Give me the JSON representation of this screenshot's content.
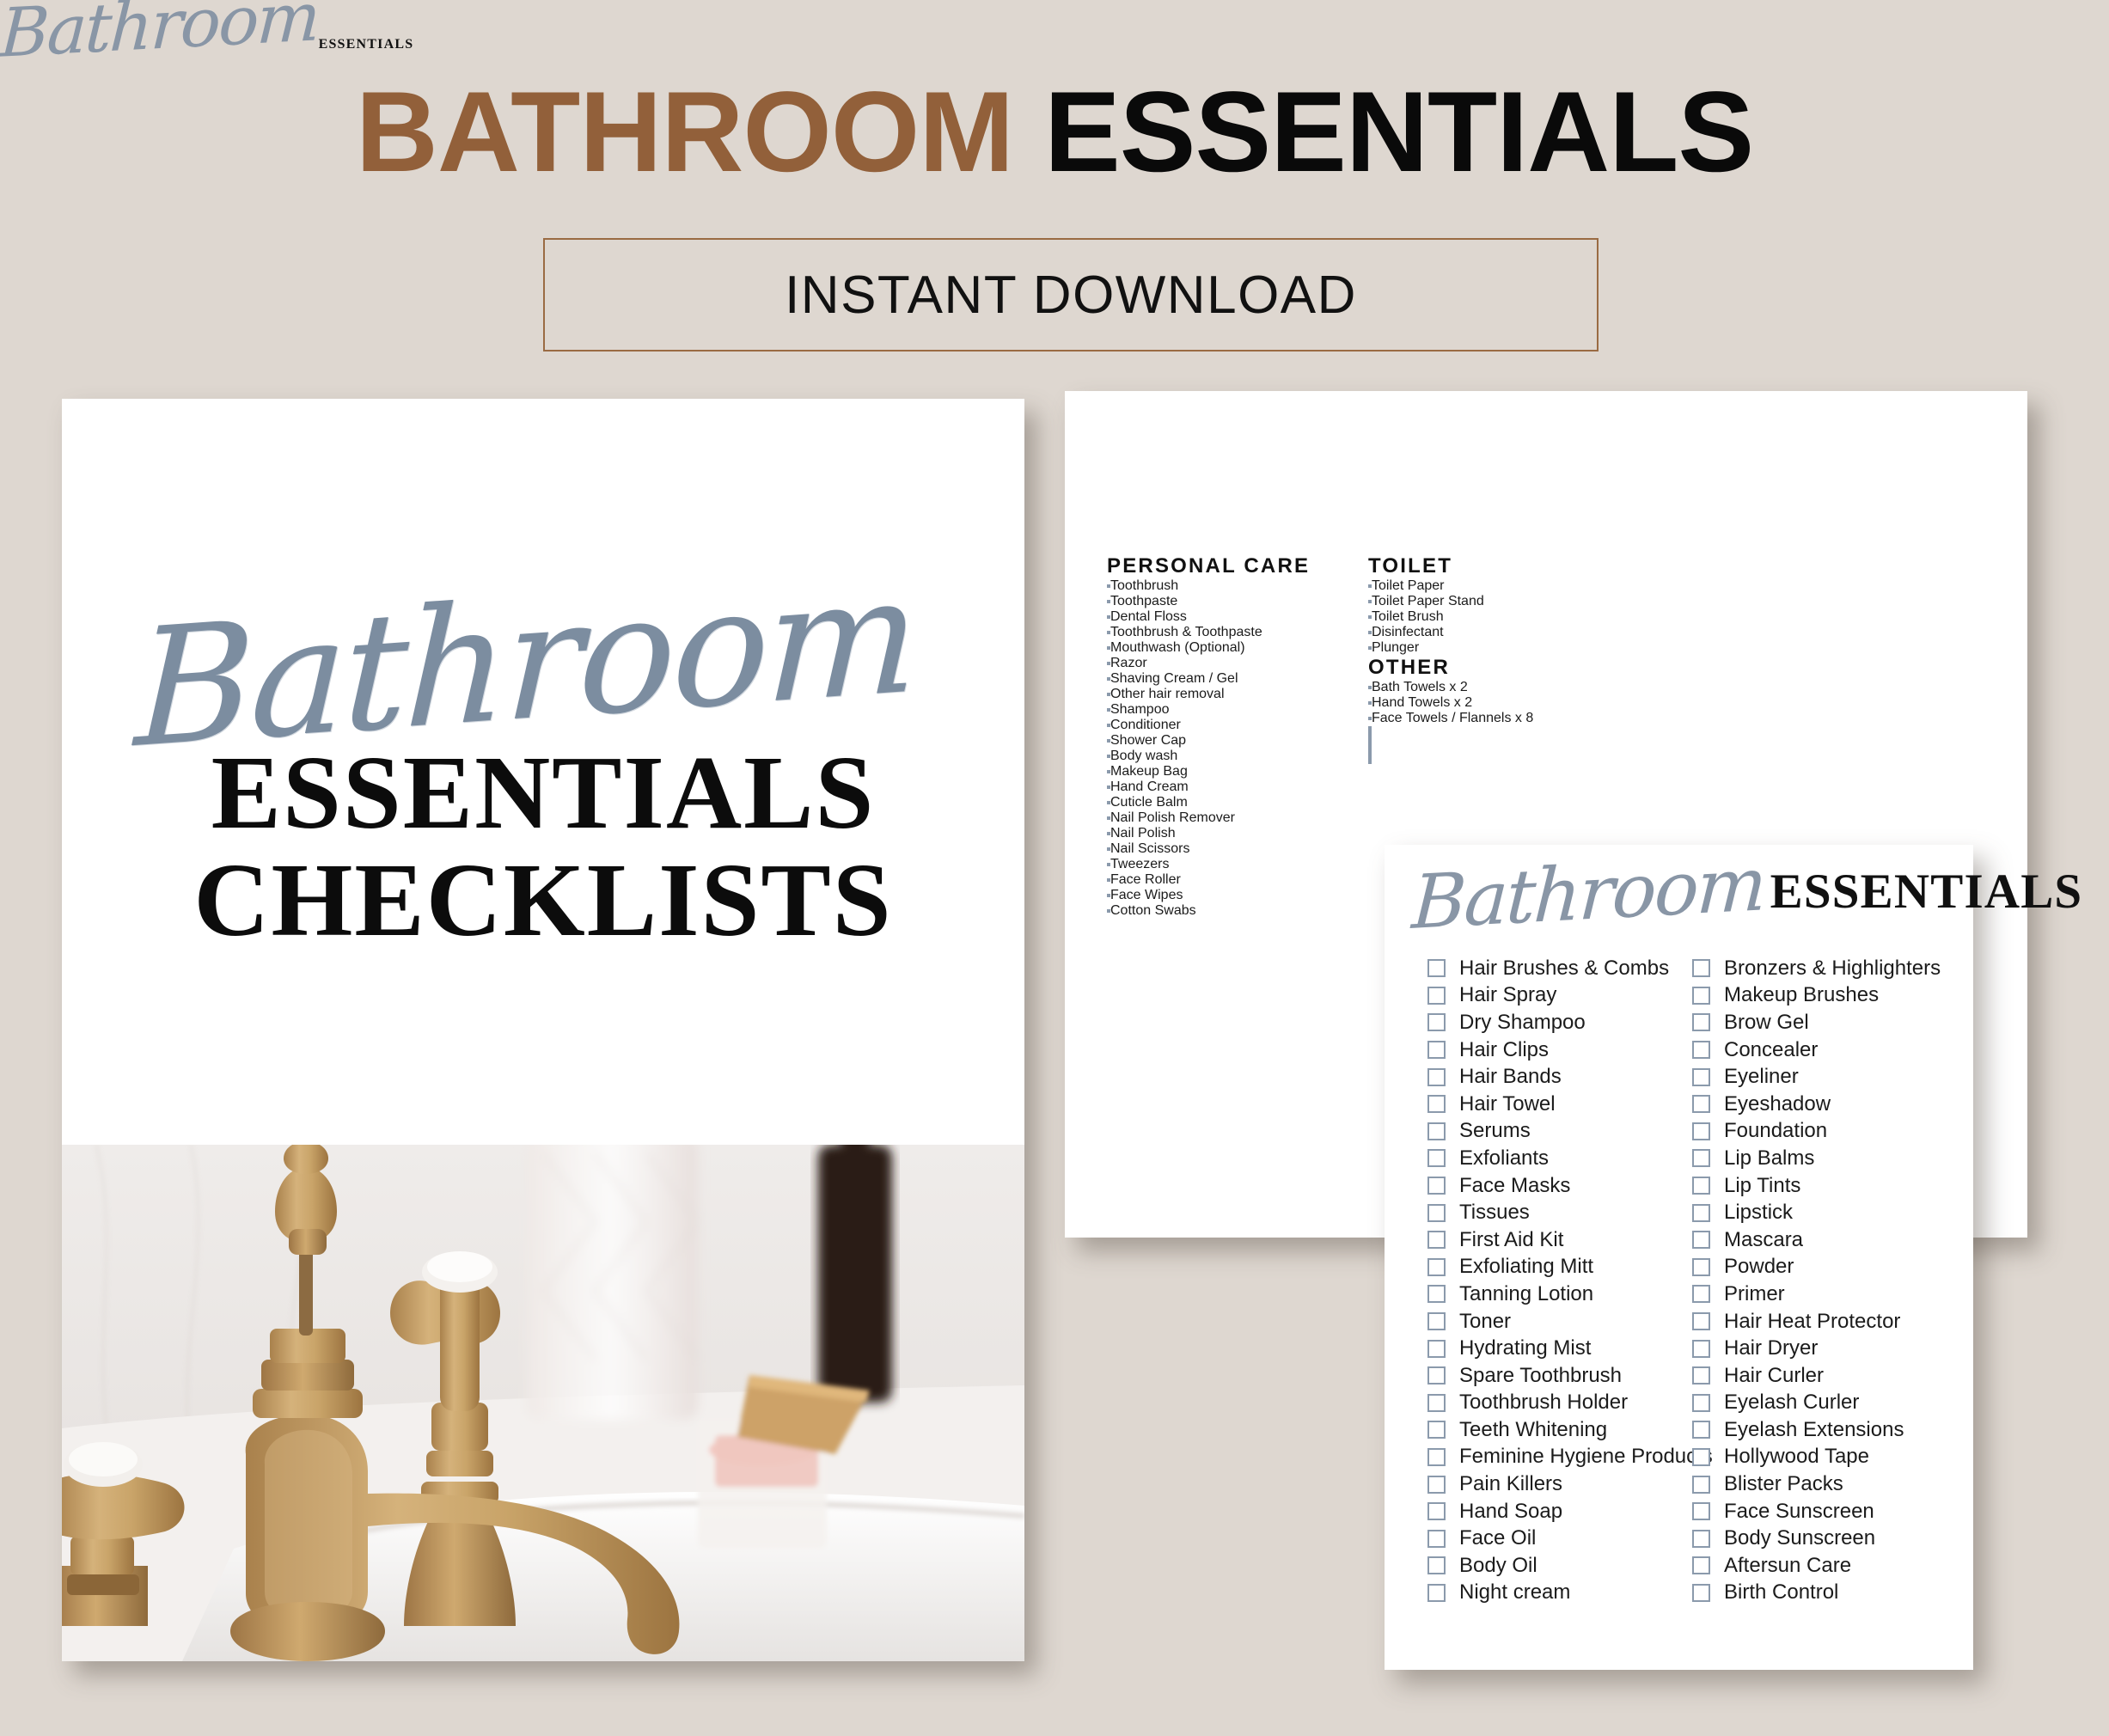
{
  "header": {
    "title_word1": "BATHROOM",
    "title_word2": "ESSENTIALS",
    "badge": "INSTANT DOWNLOAD",
    "accent_brown": "#92603a",
    "background": "#ded7d0"
  },
  "cover": {
    "script": "Bathroom",
    "line1": "ESSENTIALS",
    "line2": "CHECKLISTS",
    "photo_alt": "vintage brass bathroom faucet on white marble sink with glass jar, amber bottle and candle",
    "script_color": "#7c8da0"
  },
  "sheet2": {
    "script": "Bathroom",
    "serif": "ESSENTIALS",
    "sections": [
      {
        "heading": "PERSONAL CARE",
        "items": [
          "Toothbrush",
          "Toothpaste",
          "Dental Floss",
          "Toothbrush & Toothpaste",
          "Mouthwash (Optional)",
          "Razor",
          "Shaving Cream / Gel",
          "Other hair removal",
          "Shampoo",
          "Conditioner",
          "Shower Cap",
          "Body wash",
          "Makeup Bag",
          "Hand Cream",
          "Cuticle Balm",
          "Nail Polish Remover",
          "Nail Polish",
          "Nail Scissors",
          "Tweezers",
          "Face Roller",
          "Face Wipes",
          "Cotton Swabs"
        ]
      },
      {
        "heading": "TOILET",
        "items": [
          "Toilet Paper",
          "Toilet Paper Stand",
          "Toilet Brush",
          "Disinfectant",
          "Plunger"
        ]
      },
      {
        "heading": "OTHER",
        "items": [
          "Bath Towels x 2",
          "Hand Towels x 2",
          "Face Towels / Flannels x 8"
        ]
      }
    ],
    "hidden_row_count": 11
  },
  "sheet3": {
    "script": "Bathroom",
    "serif": "ESSENTIALS",
    "column_left": [
      "Hair Brushes & Combs",
      "Hair Spray",
      "Dry Shampoo",
      "Hair Clips",
      "Hair Bands",
      "Hair Towel",
      "Serums",
      "Exfoliants",
      "Face Masks",
      "Tissues",
      "First Aid Kit",
      "Exfoliating Mitt",
      "Tanning Lotion",
      "Toner",
      "Hydrating Mist",
      "Spare Toothbrush",
      "Toothbrush Holder",
      "Teeth Whitening",
      "Feminine Hygiene Products",
      "Pain Killers",
      "Hand Soap",
      "Face Oil",
      "Body Oil",
      "Night cream"
    ],
    "column_right": [
      "Bronzers & Highlighters",
      "Makeup Brushes",
      "Brow Gel",
      "Concealer",
      "Eyeliner",
      "Eyeshadow",
      "Foundation",
      "Lip Balms",
      "Lip Tints",
      "Lipstick",
      "Mascara",
      "Powder",
      "Primer",
      "Hair Heat Protector",
      "Hair Dryer",
      "Hair Curler",
      "Eyelash Curler",
      "Eyelash Extensions",
      "Hollywood Tape",
      "Blister Packs",
      "Face Sunscreen",
      "Body Sunscreen",
      "Aftersun Care",
      "Birth Control"
    ]
  }
}
